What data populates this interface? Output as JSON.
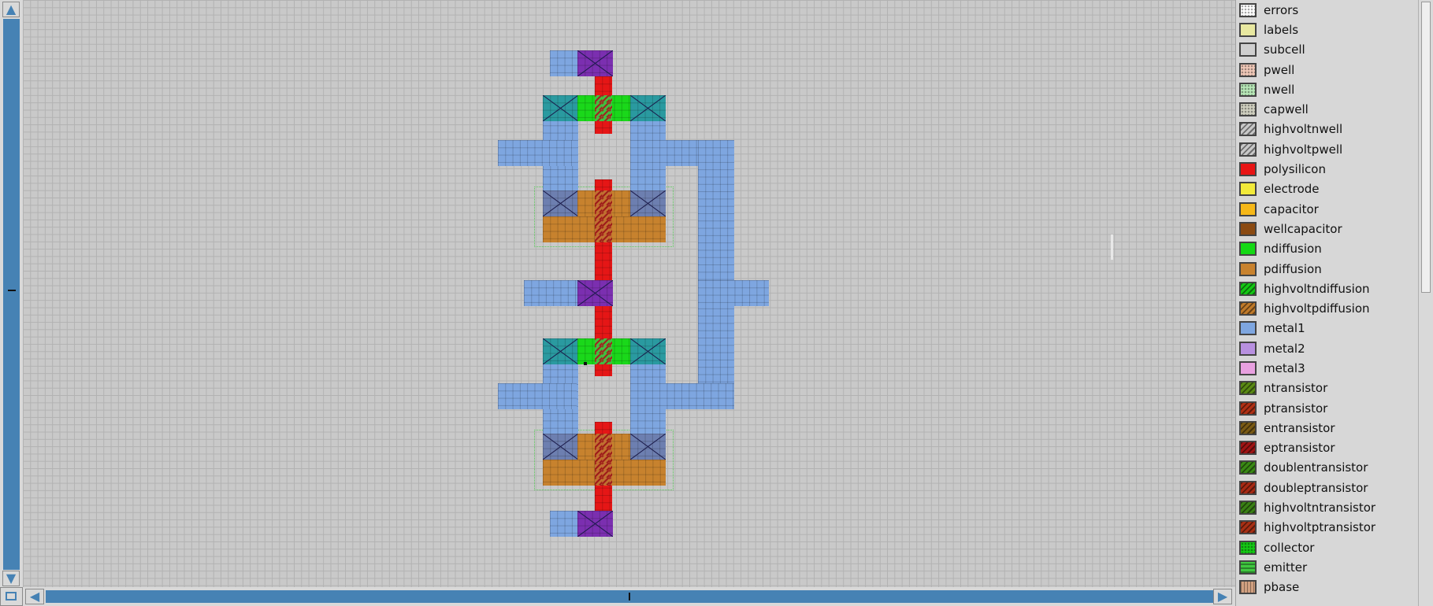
{
  "window": {
    "title": ""
  },
  "layout_editor": {
    "palette": {
      "items": [
        {
          "name": "errors",
          "color": "#ffffff",
          "pattern": "dots"
        },
        {
          "name": "labels",
          "color": "#e8e8a0",
          "pattern": "none"
        },
        {
          "name": "subcell",
          "color": "#cfcfcf",
          "pattern": "none"
        },
        {
          "name": "pwell",
          "color": "#f0c8b8",
          "pattern": "dots"
        },
        {
          "name": "nwell",
          "color": "#b8e8b8",
          "pattern": "dots"
        },
        {
          "name": "capwell",
          "color": "#d0d0c0",
          "pattern": "dots"
        },
        {
          "name": "highvoltnwell",
          "color": "#c8c8c8",
          "pattern": "hatch"
        },
        {
          "name": "highvoltpwell",
          "color": "#c8c8c8",
          "pattern": "hatch"
        },
        {
          "name": "polysilicon",
          "color": "#e81414",
          "pattern": "none"
        },
        {
          "name": "electrode",
          "color": "#f2ea3a",
          "pattern": "none"
        },
        {
          "name": "capacitor",
          "color": "#f6b818",
          "pattern": "none"
        },
        {
          "name": "wellcapacitor",
          "color": "#8a4a12",
          "pattern": "none"
        },
        {
          "name": "ndiffusion",
          "color": "#14d814",
          "pattern": "none"
        },
        {
          "name": "pdiffusion",
          "color": "#c8822e",
          "pattern": "none"
        },
        {
          "name": "highvoltndiffusion",
          "color": "#14c814",
          "pattern": "hatch"
        },
        {
          "name": "highvoltpdiffusion",
          "color": "#c07a2a",
          "pattern": "hatch"
        },
        {
          "name": "metal1",
          "color": "#7ea6e0",
          "pattern": "none"
        },
        {
          "name": "metal2",
          "color": "#b890e0",
          "pattern": "none"
        },
        {
          "name": "metal3",
          "color": "#e8a0e0",
          "pattern": "none"
        },
        {
          "name": "ntransistor",
          "color": "#5a8a14",
          "pattern": "hatch"
        },
        {
          "name": "ptransistor",
          "color": "#b03014",
          "pattern": "hatch"
        },
        {
          "name": "entransistor",
          "color": "#7a5a14",
          "pattern": "hatch"
        },
        {
          "name": "eptransistor",
          "color": "#a01414",
          "pattern": "hatch"
        },
        {
          "name": "doublentransistor",
          "color": "#3a8a14",
          "pattern": "hatch"
        },
        {
          "name": "doubleptransistor",
          "color": "#a82a14",
          "pattern": "hatch"
        },
        {
          "name": "highvoltntransistor",
          "color": "#3a8014",
          "pattern": "hatch"
        },
        {
          "name": "highvoltptransistor",
          "color": "#a83014",
          "pattern": "hatch"
        },
        {
          "name": "collector",
          "color": "#14c814",
          "pattern": "dots"
        },
        {
          "name": "emitter",
          "color": "#40c840",
          "pattern": "stripes"
        },
        {
          "name": "pbase",
          "color": "#d0a080",
          "pattern": "vstripes"
        }
      ]
    },
    "colors": {
      "scrollbar": "#4682b4",
      "background": "#c9c9c9"
    }
  }
}
